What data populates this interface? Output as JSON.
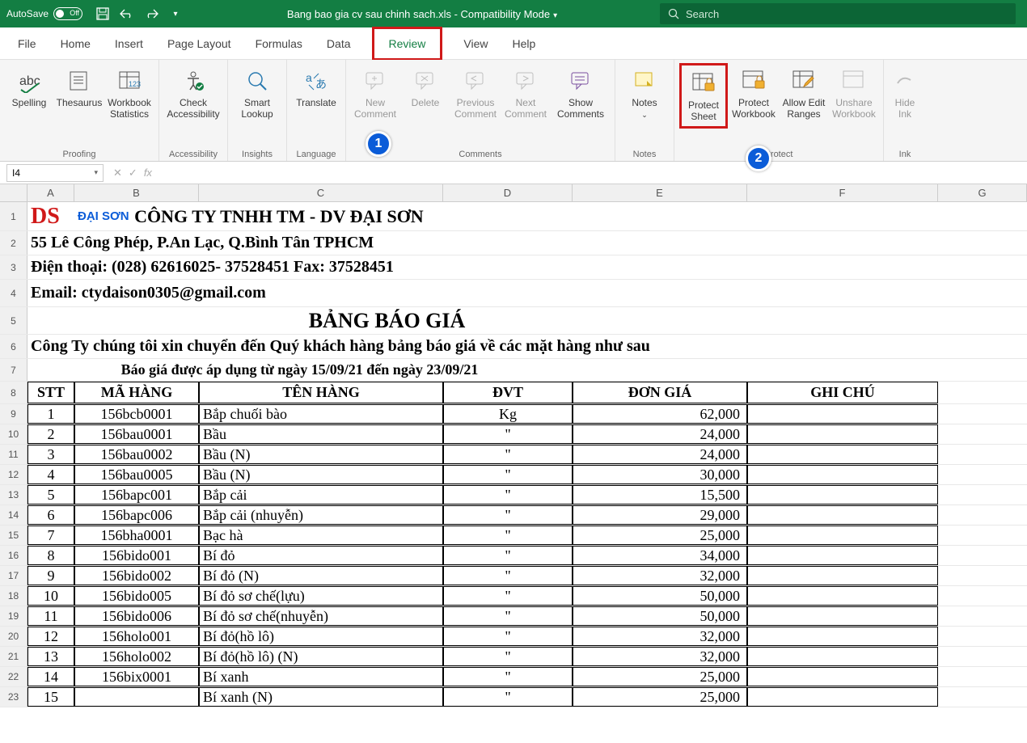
{
  "titlebar": {
    "autosave": "AutoSave",
    "autosave_state": "Off",
    "filename": "Bang bao gia cv sau chinh sach.xls",
    "mode": "Compatibility Mode",
    "search_placeholder": "Search"
  },
  "tabs": {
    "file": "File",
    "home": "Home",
    "insert": "Insert",
    "page_layout": "Page Layout",
    "formulas": "Formulas",
    "data": "Data",
    "review": "Review",
    "view": "View",
    "help": "Help"
  },
  "ribbon": {
    "spelling": "Spelling",
    "thesaurus": "Thesaurus",
    "workbook_stats": "Workbook\nStatistics",
    "proofing": "Proofing",
    "check_access": "Check\nAccessibility",
    "accessibility": "Accessibility",
    "smart_lookup": "Smart\nLookup",
    "insights": "Insights",
    "translate": "Translate",
    "language": "Language",
    "new_comment": "New\nComment",
    "delete": "Delete",
    "prev_comment": "Previous\nComment",
    "next_comment": "Next\nComment",
    "show_comments": "Show\nComments",
    "comments": "Comments",
    "notes": "Notes",
    "notes_grp": "Notes",
    "protect_sheet": "Protect\nSheet",
    "protect_wb": "Protect\nWorkbook",
    "allow_edit": "Allow Edit\nRanges",
    "unshare_wb": "Unshare\nWorkbook",
    "protect": "Protect",
    "hide_ink": "Hide\nInk",
    "ink": "Ink"
  },
  "badges": {
    "b1": "1",
    "b2": "2"
  },
  "formula": {
    "cell_ref": "I4",
    "fx": "fx"
  },
  "columns": [
    "A",
    "B",
    "C",
    "D",
    "E",
    "F",
    "G"
  ],
  "doc": {
    "logo_name": "ĐẠI SƠN",
    "company": "CÔNG TY TNHH TM - DV ĐẠI SƠN",
    "address": "55 Lê Công Phép, P.An Lạc, Q.Bình Tân  TPHCM",
    "phone": "Điện thoại: (028) 62616025- 37528451 Fax: 37528451",
    "email": "Email: ctydaison0305@gmail.com",
    "heading": "BẢNG BÁO GIÁ",
    "sub": "Công Ty chúng tôi xin chuyển đến Quý khách hàng bảng báo giá về các mặt hàng như sau",
    "dateline": "Báo giá được áp dụng từ ngày 15/09/21 đến ngày 23/09/21"
  },
  "headers": {
    "stt": "STT",
    "mahang": "MÃ HÀNG",
    "tenhang": "TÊN HÀNG",
    "dvt": "ĐVT",
    "dongia": "ĐƠN GIÁ",
    "ghichu": "GHI CHÚ"
  },
  "rows": [
    {
      "n": "1",
      "code": "156bcb0001",
      "name": "Bắp chuối bào",
      "dvt": "Kg",
      "price": "62,000"
    },
    {
      "n": "2",
      "code": "156bau0001",
      "name": "Bầu",
      "dvt": "\"",
      "price": "24,000"
    },
    {
      "n": "3",
      "code": "156bau0002",
      "name": "Bầu (N)",
      "dvt": "\"",
      "price": "24,000"
    },
    {
      "n": "4",
      "code": "156bau0005",
      "name": "Bầu (N)",
      "dvt": "\"",
      "price": "30,000"
    },
    {
      "n": "5",
      "code": "156bapc001",
      "name": "Bắp cải",
      "dvt": "\"",
      "price": "15,500"
    },
    {
      "n": "6",
      "code": "156bapc006",
      "name": "Bắp cải (nhuyễn)",
      "dvt": "\"",
      "price": "29,000"
    },
    {
      "n": "7",
      "code": "156bha0001",
      "name": "Bạc hà",
      "dvt": "\"",
      "price": "25,000"
    },
    {
      "n": "8",
      "code": "156bido001",
      "name": "Bí đỏ",
      "dvt": "\"",
      "price": "34,000"
    },
    {
      "n": "9",
      "code": "156bido002",
      "name": "Bí đỏ (N)",
      "dvt": "\"",
      "price": "32,000"
    },
    {
      "n": "10",
      "code": "156bido005",
      "name": "Bí đỏ sơ chế(lựu)",
      "dvt": "\"",
      "price": "50,000"
    },
    {
      "n": "11",
      "code": "156bido006",
      "name": "Bí đỏ sơ chế(nhuyễn)",
      "dvt": "\"",
      "price": "50,000"
    },
    {
      "n": "12",
      "code": "156holo001",
      "name": "Bí đỏ(hồ lô)",
      "dvt": "\"",
      "price": "32,000"
    },
    {
      "n": "13",
      "code": "156holo002",
      "name": "Bí đỏ(hồ lô) (N)",
      "dvt": "\"",
      "price": "32,000"
    },
    {
      "n": "14",
      "code": "156bix0001",
      "name": "Bí xanh",
      "dvt": "\"",
      "price": "25,000"
    },
    {
      "n": "15",
      "code": "",
      "name": "Bí xanh (N)",
      "dvt": "\"",
      "price": "25,000"
    }
  ]
}
